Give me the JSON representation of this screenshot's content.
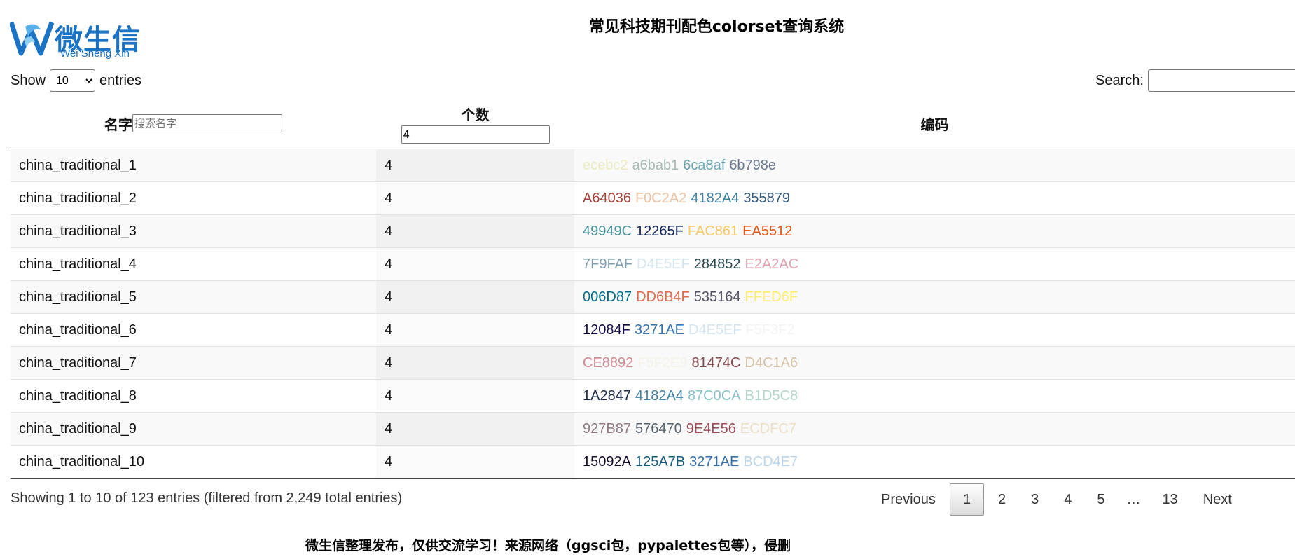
{
  "brand": {
    "name_cn": "微生信",
    "name_en": "Wei Sheng Xin",
    "color": "#1a73c4"
  },
  "page_title": "常见科技期刊配色colorset查询系统",
  "length_control": {
    "prefix": "Show",
    "selected": "10",
    "options": [
      "10"
    ],
    "suffix": "entries"
  },
  "search": {
    "label": "Search:",
    "value": ""
  },
  "table": {
    "columns": {
      "name": "名字",
      "count": "个数",
      "codes": "编码"
    },
    "filters": {
      "name_placeholder": "搜索名字",
      "count_value": "4"
    },
    "rows": [
      {
        "name": "china_traditional_1",
        "count": "4",
        "codes": [
          {
            "text": "ecebc2",
            "color": "#ecebc2"
          },
          {
            "text": "a6bab1",
            "color": "#a6bab1"
          },
          {
            "text": "6ca8af",
            "color": "#6ca8af"
          },
          {
            "text": "6b798e",
            "color": "#6b798e"
          }
        ]
      },
      {
        "name": "china_traditional_2",
        "count": "4",
        "codes": [
          {
            "text": "A64036",
            "color": "#A64036"
          },
          {
            "text": "F0C2A2",
            "color": "#F0C2A2"
          },
          {
            "text": "4182A4",
            "color": "#4182A4"
          },
          {
            "text": "355879",
            "color": "#355879"
          }
        ]
      },
      {
        "name": "china_traditional_3",
        "count": "4",
        "codes": [
          {
            "text": "49949C",
            "color": "#49949C"
          },
          {
            "text": "12265F",
            "color": "#12265F"
          },
          {
            "text": "FAC861",
            "color": "#FAC861"
          },
          {
            "text": "EA5512",
            "color": "#EA5512"
          }
        ]
      },
      {
        "name": "china_traditional_4",
        "count": "4",
        "codes": [
          {
            "text": "7F9FAF",
            "color": "#7F9FAF"
          },
          {
            "text": "D4E5EF",
            "color": "#D4E5EF"
          },
          {
            "text": "284852",
            "color": "#284852"
          },
          {
            "text": "E2A2AC",
            "color": "#E2A2AC"
          }
        ]
      },
      {
        "name": "china_traditional_5",
        "count": "4",
        "codes": [
          {
            "text": "006D87",
            "color": "#006D87"
          },
          {
            "text": "DD6B4F",
            "color": "#DD6B4F"
          },
          {
            "text": "535164",
            "color": "#535164"
          },
          {
            "text": "FFED6F",
            "color": "#FFED6F"
          }
        ]
      },
      {
        "name": "china_traditional_6",
        "count": "4",
        "codes": [
          {
            "text": "12084F",
            "color": "#12084F"
          },
          {
            "text": "3271AE",
            "color": "#3271AE"
          },
          {
            "text": "D4E5EF",
            "color": "#D4E5EF"
          },
          {
            "text": "F5F3F2",
            "color": "#F5F3F2"
          }
        ]
      },
      {
        "name": "china_traditional_7",
        "count": "4",
        "codes": [
          {
            "text": "CE8892",
            "color": "#CE8892"
          },
          {
            "text": "F5F2E9",
            "color": "#F5F2E9"
          },
          {
            "text": "81474C",
            "color": "#81474C"
          },
          {
            "text": "D4C1A6",
            "color": "#D4C1A6"
          }
        ]
      },
      {
        "name": "china_traditional_8",
        "count": "4",
        "codes": [
          {
            "text": "1A2847",
            "color": "#1A2847"
          },
          {
            "text": "4182A4",
            "color": "#4182A4"
          },
          {
            "text": "87C0CA",
            "color": "#87C0CA"
          },
          {
            "text": "B1D5C8",
            "color": "#B1D5C8"
          }
        ]
      },
      {
        "name": "china_traditional_9",
        "count": "4",
        "codes": [
          {
            "text": "927B87",
            "color": "#927B87"
          },
          {
            "text": "576470",
            "color": "#576470"
          },
          {
            "text": "9E4E56",
            "color": "#9E4E56"
          },
          {
            "text": "ECDFC7",
            "color": "#ECDFC7"
          }
        ]
      },
      {
        "name": "china_traditional_10",
        "count": "4",
        "codes": [
          {
            "text": "15092A",
            "color": "#15092A"
          },
          {
            "text": "125A7B",
            "color": "#125A7B"
          },
          {
            "text": "3271AE",
            "color": "#3271AE"
          },
          {
            "text": "BCD4E7",
            "color": "#BCD4E7"
          }
        ]
      }
    ]
  },
  "info_text": "Showing 1 to 10 of 123 entries (filtered from 2,249 total entries)",
  "pagination": {
    "previous": "Previous",
    "pages": [
      "1",
      "2",
      "3",
      "4",
      "5"
    ],
    "ellipsis": "…",
    "last": "13",
    "next": "Next",
    "current": "1"
  },
  "footer": "微生信整理发布，仅供交流学习！来源网络（ggsci包，pypalettes包等），侵删"
}
